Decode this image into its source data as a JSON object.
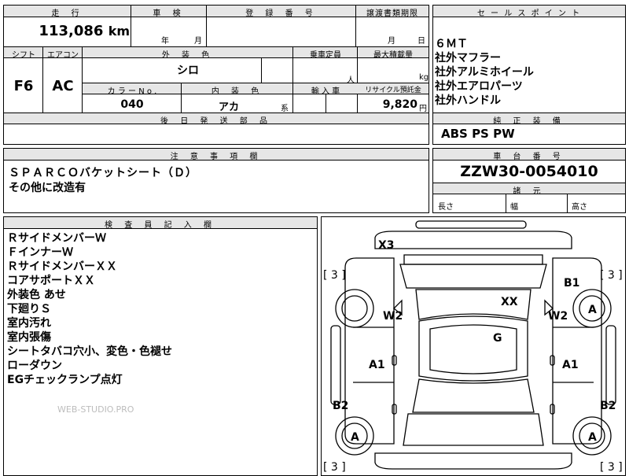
{
  "top_left": {
    "mileage_label": "走 行",
    "mileage_value": "113,086",
    "mileage_unit": "km",
    "shaken_label": "車 検",
    "shaken_year": "年",
    "shaken_month": "月",
    "reg_label": "登 録 番 号",
    "transfer_label": "譲渡書類期限",
    "transfer_month": "月",
    "transfer_day": "日",
    "shift_label": "シフト",
    "ac_label": "エアコン",
    "exterior_label": "外 装 色",
    "exterior_value": "シロ",
    "capacity_label": "乗車定員",
    "capacity_unit": "人",
    "load_label": "最大積載量",
    "load_unit": "kg",
    "shift_value": "F6",
    "ac_value": "AC",
    "color_no_label": "カ ラ ー N o .",
    "interior_label": "内 装 色",
    "import_label": "輸 入 車",
    "recycle_label": "リサイクル預託金",
    "color_no_value": "040",
    "interior_value": "アカ",
    "interior_suffix": "系",
    "recycle_value": "9,820",
    "recycle_unit": "円",
    "parts_label": "後 日 発 送 部 品"
  },
  "sales_point": {
    "label": "セ ー ル ス ポ イ ン ト",
    "items": [
      "６ＭＴ",
      "社外マフラー",
      "社外アルミホイール",
      "社外エアロパーツ",
      "社外ハンドル"
    ]
  },
  "equipment": {
    "label": "純 正 装 備",
    "value": "ABS PS PW"
  },
  "notes": {
    "label": "注 意 事 項 欄",
    "lines": [
      "ＳＰＡＲＣＯバケットシート（Ｄ）",
      "その他に改造有"
    ]
  },
  "chassis": {
    "label": "車 台 番 号",
    "value": "ZZW30-0054010",
    "dims_label": "諸 元",
    "length_label": "長さ",
    "width_label": "幅",
    "height_label": "高さ"
  },
  "inspector": {
    "label": "検 査 員 記 入 欄",
    "lines": [
      "ＲサイドメンバーＷ",
      "ＦインナーＷ",
      "ＲサイドメンバーＸＸ",
      "コアサポートＸＸ",
      "外装色 あせ",
      "下廻りＳ",
      "室内汚れ",
      "室内張傷",
      "シートタバコ穴小、変色・色褪せ",
      "ローダウン",
      "EGチェックランプ点灯"
    ],
    "watermark": "WEB-STUDIO.PRO"
  },
  "diagram": {
    "marks": {
      "x3": "X3",
      "xx": "XX",
      "w2_left": "W2",
      "w2_right": "W2",
      "b1": "B1",
      "g": "G",
      "a1_left": "A1",
      "a1_right": "A1",
      "b2_left": "B2",
      "b2_right": "B2",
      "a_wheel_fr": "A",
      "a_wheel_rl": "A",
      "a_wheel_rr": "A"
    },
    "corner_tl": "[ 3 ]",
    "corner_tr": "[ 3 ]",
    "corner_bl": "[ 3 ]",
    "corner_br": "[ 3 ]"
  }
}
